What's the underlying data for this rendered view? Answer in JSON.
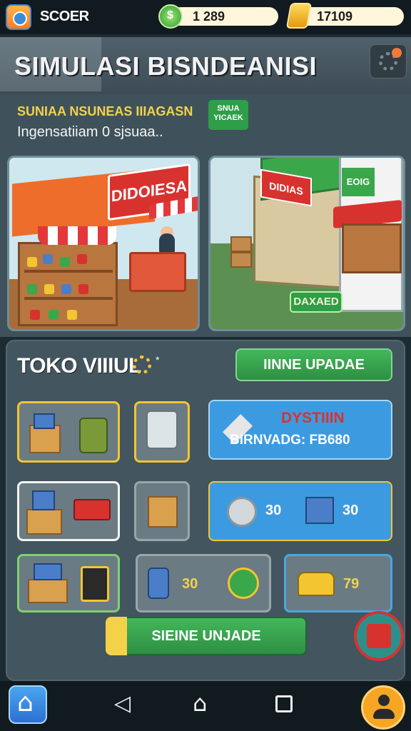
{
  "topbar": {
    "app_name": "SCOER",
    "gems": "1 289",
    "coins": "17109"
  },
  "header": {
    "title": "SIMULASI BISNDEANISI"
  },
  "intro": {
    "subtitle": "SUNIAA NSUNEAS IIIAGASN",
    "description": "Ingensatiiam 0 sjsuaa..",
    "tag": "SNUA YICAEK",
    "left_scene_sign": "DIDOIESA",
    "right_scene_sign": "DIDIAS",
    "right_tower_sign": "EOIG",
    "scene_badge": "DAXAED"
  },
  "store": {
    "title": "TOKO VIIIUL",
    "star": "*",
    "online_button": "IINNE UPADAE",
    "card_a": {
      "title": "DYSTIIIN",
      "subtitle": "BIRNVADG: FB680"
    },
    "card_b": {
      "value_1": "30",
      "value_2": "30"
    },
    "tile_green_value": "30",
    "tile_car_value": "79",
    "upgrade_button": "SIEINE UNJADE"
  },
  "colors": {
    "accent_green": "#2e9e48",
    "accent_yellow": "#f3c531",
    "accent_blue": "#3c9be0",
    "accent_red": "#d8322f"
  },
  "icons": [
    "app-logo-icon",
    "gem-icon",
    "coin-icon",
    "settings-gear-icon",
    "home-icon",
    "back-icon",
    "recent-apps-icon",
    "profile-icon",
    "close-icon"
  ]
}
